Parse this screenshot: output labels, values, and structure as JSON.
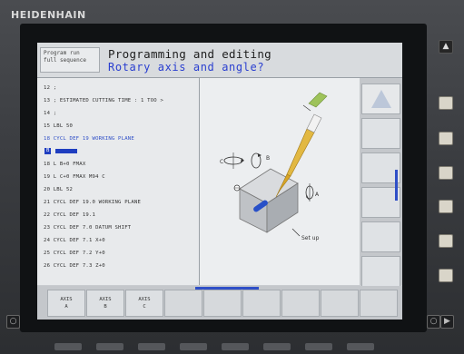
{
  "bezel": {
    "brand": "HEIDENHAIN",
    "up_key_label": "▲"
  },
  "header": {
    "mode_line1": "Program run",
    "mode_line2": "full sequence",
    "title": "Programming and editing",
    "question": "Rotary axis and angle?"
  },
  "program": {
    "lines": [
      "12 ;",
      "13 ; ESTIMATED CUTTING TIME :  1 TOO >",
      "14 ;",
      "15 LBL 50",
      "18 CYCL DEF 19 WORKING PLANE",
      "18 L  B+0 FMAX",
      "19 L  C+0 FMAX M94 C",
      "20 LBL 52",
      "21 CYCL DEF 19.0 WORKING PLANE",
      "22 CYCL DEF 19.1",
      "23 CYCL DEF 7.0 DATUM SHIFT",
      "24 CYCL DEF 7.1  X+0",
      "25 CYCL DEF 7.2  Y+0",
      "26 CYCL DEF 7.3  Z+0"
    ],
    "cursor_number": "B"
  },
  "graphic": {
    "label_c": "C",
    "label_b": "B",
    "label_a": "A",
    "label_setup": "Set up"
  },
  "softkeys_bottom": [
    {
      "line1": "AXIS",
      "line2": "A"
    },
    {
      "line1": "AXIS",
      "line2": "B"
    },
    {
      "line1": "AXIS",
      "line2": "C"
    },
    {
      "line1": "",
      "line2": ""
    },
    {
      "line1": "",
      "line2": ""
    },
    {
      "line1": "",
      "line2": ""
    },
    {
      "line1": "",
      "line2": ""
    },
    {
      "line1": "",
      "line2": ""
    },
    {
      "line1": "",
      "line2": ""
    }
  ],
  "colors": {
    "accent": "#2f4fc7",
    "question_text": "#2a3fd0",
    "tool": "#d8a526"
  }
}
